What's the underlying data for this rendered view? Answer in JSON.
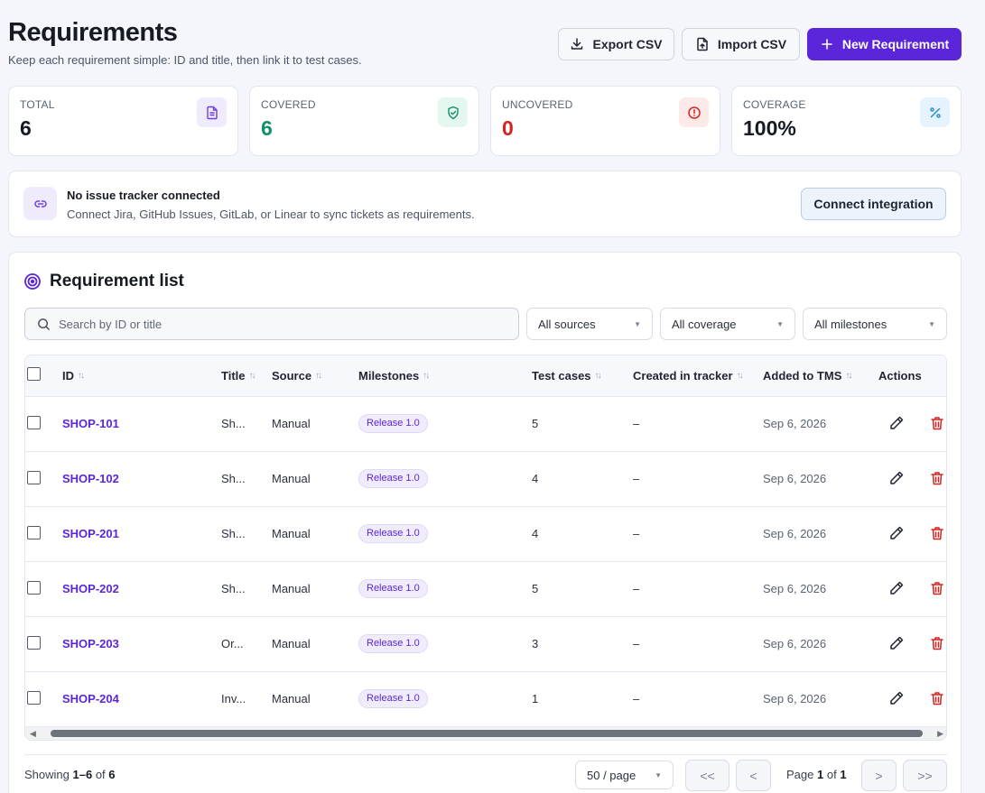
{
  "header": {
    "title": "Requirements",
    "subtitle": "Keep each requirement simple: ID and title, then link it to test cases.",
    "export_label": "Export CSV",
    "import_label": "Import CSV",
    "new_label": "New Requirement"
  },
  "stats": [
    {
      "label": "TOTAL",
      "value": "6",
      "color": "#161a22",
      "icon": "document-icon",
      "icon_color": "#6d3fe0",
      "icon_bg": "#efeafc"
    },
    {
      "label": "COVERED",
      "value": "6",
      "color": "#0f8f6a",
      "icon": "shield-check-icon",
      "icon_color": "#0f8f6a",
      "icon_bg": "#e3f7ef"
    },
    {
      "label": "UNCOVERED",
      "value": "0",
      "color": "#d5221f",
      "icon": "alert-circle-icon",
      "icon_color": "#d5221f",
      "icon_bg": "#fde9e8"
    },
    {
      "label": "COVERAGE",
      "value": "100%",
      "color": "#161a22",
      "icon": "percent-icon",
      "icon_color": "#2e8fd6",
      "icon_bg": "#e6f3fc"
    }
  ],
  "integration": {
    "title": "No issue tracker connected",
    "description": "Connect Jira, GitHub Issues, GitLab, or Linear to sync tickets as requirements.",
    "button": "Connect integration"
  },
  "list": {
    "title": "Requirement list",
    "search_placeholder": "Search by ID or title",
    "filters": [
      "All sources",
      "All coverage",
      "All milestones"
    ],
    "columns": [
      "ID",
      "Title",
      "Source",
      "Milestones",
      "Test cases",
      "Created in tracker",
      "Added to TMS",
      "Actions"
    ],
    "rows": [
      {
        "id": "SHOP-101",
        "title": "Sh...",
        "source": "Manual",
        "milestone": "Release 1.0",
        "tests": "5",
        "created": "–",
        "added": "Sep 6, 2026"
      },
      {
        "id": "SHOP-102",
        "title": "Sh...",
        "source": "Manual",
        "milestone": "Release 1.0",
        "tests": "4",
        "created": "–",
        "added": "Sep 6, 2026"
      },
      {
        "id": "SHOP-201",
        "title": "Sh...",
        "source": "Manual",
        "milestone": "Release 1.0",
        "tests": "4",
        "created": "–",
        "added": "Sep 6, 2026"
      },
      {
        "id": "SHOP-202",
        "title": "Sh...",
        "source": "Manual",
        "milestone": "Release 1.0",
        "tests": "5",
        "created": "–",
        "added": "Sep 6, 2026"
      },
      {
        "id": "SHOP-203",
        "title": "Or...",
        "source": "Manual",
        "milestone": "Release 1.0",
        "tests": "3",
        "created": "–",
        "added": "Sep 6, 2026"
      },
      {
        "id": "SHOP-204",
        "title": "Inv...",
        "source": "Manual",
        "milestone": "Release 1.0",
        "tests": "1",
        "created": "–",
        "added": "Sep 6, 2026"
      }
    ]
  },
  "footer": {
    "showing_prefix": "Showing",
    "range": "1–6",
    "of": "of",
    "total": "6",
    "per_page": "50 / page",
    "first": "<<",
    "prev": "<",
    "next": ">",
    "last": ">>",
    "page_word": "Page",
    "page": "1",
    "page_of": "of",
    "pages": "1"
  },
  "colors": {
    "accent": "#5b26d9",
    "danger": "#d5221f",
    "success": "#0f8f6a"
  }
}
